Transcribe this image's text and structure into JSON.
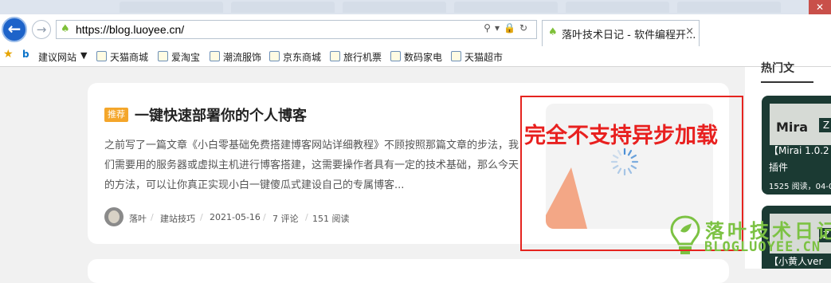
{
  "browser": {
    "url": "https://blog.luoyee.cn/",
    "active_tab_title": "落叶技术日记 - 软件编程开...",
    "tab_close_glyph": "×",
    "favorites": {
      "suggested_sites": "建议网站",
      "items": [
        "天猫商城",
        "爱淘宝",
        "潮流服饰",
        "京东商城",
        "旅行机票",
        "数码家电",
        "天猫超市"
      ]
    }
  },
  "post": {
    "badge": "推荐",
    "title": "一键快速部署你的个人博客",
    "excerpt": "之前写了一篇文章《小白零基础免费搭建博客网站详细教程》不顾按照那篇文章的步法，我们需要用的服务器或虚拟主机进行博客搭建，这需要操作者具有一定的技术基础，那么今天的方法，可以让你真正实现小白一键傻瓜式建设自己的专属博客...",
    "author": "落叶",
    "category": "建站技巧",
    "date": "2021-05-16",
    "comments": "7 评论",
    "views": "151 阅读"
  },
  "annotation": {
    "text": "完全不支持异步加载",
    "color": "#e8201f"
  },
  "sidebar": {
    "heading": "热门文",
    "card1": {
      "image_text": "Mira",
      "title": "【Mirai 1.0.2",
      "subtitle": "插件",
      "stats": "1525 阅读，04-0"
    },
    "card2": {
      "title": "【小黄人ver"
    },
    "corner_letter": "Z"
  },
  "watermark": {
    "cn": "落叶技术日记",
    "en": "BLOGLUOYEE.CN",
    "color": "#7cc243"
  }
}
